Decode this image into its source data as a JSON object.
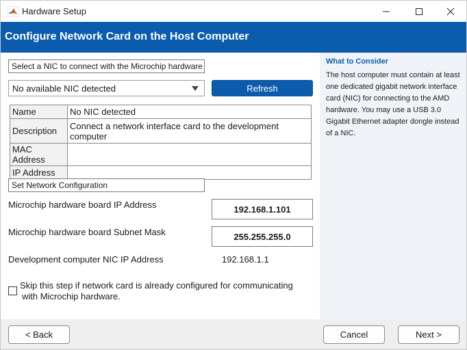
{
  "window": {
    "title": "Hardware Setup",
    "minimize_glyph": "—",
    "maximize_glyph": "☐",
    "close_glyph": "✕"
  },
  "banner": {
    "title": "Configure Network Card on the Host Computer"
  },
  "nic_section": {
    "select_label": "Select a NIC to connect with the Microchip hardware",
    "dropdown_value": "No available NIC detected",
    "refresh_label": "Refresh",
    "table": {
      "rows": [
        {
          "key": "Name",
          "value": "No NIC detected"
        },
        {
          "key": "Description",
          "value": "Connect a network interface card to the development computer"
        },
        {
          "key": "MAC Address",
          "value": ""
        },
        {
          "key": "IP Address",
          "value": ""
        }
      ]
    }
  },
  "network_config": {
    "section_label": "Set Network Configuration",
    "board_ip_label": "Microchip hardware board IP Address",
    "board_ip_value": "192.168.1.101",
    "subnet_label": "Microchip hardware board Subnet Mask",
    "subnet_value": "255.255.255.0",
    "dev_nic_label": "Development computer NIC IP Address",
    "dev_nic_value": "192.168.1.1"
  },
  "skip": {
    "checked": false,
    "line1": "Skip this step if network card is already configured for communicating",
    "line2": "with Microchip hardware."
  },
  "info": {
    "heading": "What to Consider",
    "body": "The host computer must contain at least one dedicated gigabit network interface card (NIC) for connecting to the AMD hardware. You may use a USB 3.0 Gigabit Ethernet adapter dongle instead of a NIC."
  },
  "footer": {
    "back_label": "< Back",
    "cancel_label": "Cancel",
    "next_label": "Next >"
  },
  "colors": {
    "banner": "#0b5cad",
    "info_pane": "#f0f4f9",
    "footer": "#efefef",
    "accent_text": "#0b5cad"
  },
  "icons": {
    "app": "matlab-membrane-icon",
    "dropdown": "chevron-down-icon"
  }
}
